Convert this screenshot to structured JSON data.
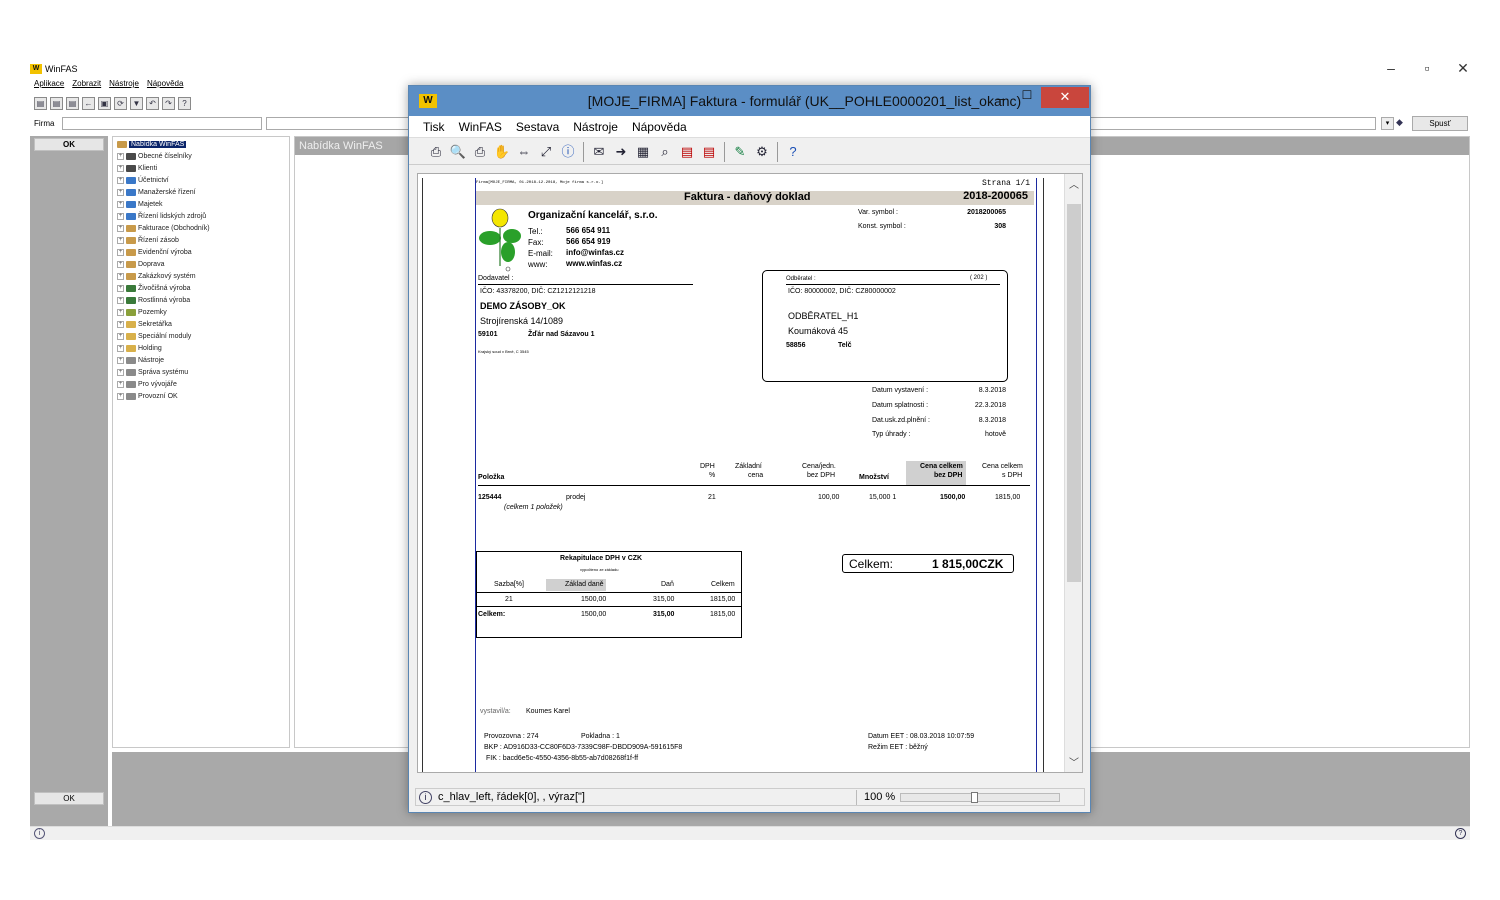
{
  "app": {
    "title": "WinFAS",
    "menu": [
      "Aplikace",
      "Zobrazit",
      "Nástroje",
      "Nápověda"
    ],
    "firma_label": "Firma",
    "spust_label": "Spusť",
    "ok_label": "OK",
    "ok_bottom_label": "OK",
    "right_header": "Nabídka WinFAS",
    "tree_root": "Nabídka WinFAS",
    "tree_items": [
      {
        "label": "Obecné číselníky",
        "color": "#4a4a4a"
      },
      {
        "label": "Klienti",
        "color": "#4a4a4a"
      },
      {
        "label": "Účetnictví",
        "color": "#3a78c8"
      },
      {
        "label": "Manažerské řízení",
        "color": "#3a78c8"
      },
      {
        "label": "Majetek",
        "color": "#3a78c8"
      },
      {
        "label": "Řízení lidských zdrojů",
        "color": "#3a78c8"
      },
      {
        "label": "Fakturace (Obchodník)",
        "color": "#c89a4a"
      },
      {
        "label": "Řízení zásob",
        "color": "#c89a4a"
      },
      {
        "label": "Evidenční výroba",
        "color": "#c89a4a"
      },
      {
        "label": "Doprava",
        "color": "#c89a4a"
      },
      {
        "label": "Zakázkový systém",
        "color": "#c89a4a"
      },
      {
        "label": "Živočišná výroba",
        "color": "#3a7a3a"
      },
      {
        "label": "Rostlinná výroba",
        "color": "#3a7a3a"
      },
      {
        "label": "Pozemky",
        "color": "#8aa03a"
      },
      {
        "label": "Sekretářka",
        "color": "#d8b04a"
      },
      {
        "label": "Speciální moduly",
        "color": "#d8b04a"
      },
      {
        "label": "Holding",
        "color": "#d8b04a"
      },
      {
        "label": "Nástroje",
        "color": "#8a8a8a"
      },
      {
        "label": "Správa systému",
        "color": "#8a8a8a"
      },
      {
        "label": "Pro vývojáře",
        "color": "#8a8a8a"
      },
      {
        "label": "Provozní OK",
        "color": "#8a8a8a"
      }
    ]
  },
  "dialog": {
    "title": "[MOJE_FIRMA] Faktura - formulář (UK__POHLE0000201_list_okanc)",
    "menu": [
      "Tisk",
      "WinFAS",
      "Sestava",
      "Nástroje",
      "Nápověda"
    ],
    "status_text": "c_hlav_left, řádek[0], , výraz[\"]",
    "zoom": "100 %",
    "zoom_fraction": 0.46
  },
  "invoice": {
    "header_left": "Firma[MOJE_FIRMA, 01.2018-12.2018, Moje firma s.r.o.]",
    "header_right": "Strana 1/1",
    "doc_title": "Faktura - daňový doklad",
    "doc_number": "2018-200065",
    "company_name": "Organizační kancelář, s.r.o.",
    "tel_label": "Tel.:",
    "tel": "566 654 911",
    "fax_label": "Fax:",
    "fax": "566 654 919",
    "email_label": "E-mail:",
    "email": "info@winfas.cz",
    "www_label": "www:",
    "www": "www.winfas.cz",
    "var_symbol_label": "Var. symbol :",
    "var_symbol": "2018200065",
    "konst_symbol_label": "Konst. symbol :",
    "konst_symbol": "308",
    "dodavatel_label": "Dodavatel :",
    "dodavatel_ico": "IČO: 43378200, DIČ: CZ1212121218",
    "dodavatel_name": "DEMO ZÁSOBY_OK",
    "dodavatel_street": "Strojírenská 14/1089",
    "dodavatel_zip": "59101",
    "dodavatel_city": "Žďár nad Sázavou 1",
    "dodavatel_court": "Krajský soud v Brně, C 3545",
    "odberatel_label": "Odběratel :",
    "odberatel_code": "( 202 )",
    "odberatel_ico": "IČO: 80000002, DIČ: CZ80000002",
    "odberatel_name": "ODBĚRATEL_H1",
    "odberatel_street": "Koumáková 45",
    "odberatel_zip": "58856",
    "odberatel_city": "Telč",
    "dates": [
      {
        "label": "Datum vystavení :",
        "value": "8.3.2018"
      },
      {
        "label": "Datum splatnosti :",
        "value": "22.3.2018"
      },
      {
        "label": "Dat.usk.zd.plnění :",
        "value": "8.3.2018"
      },
      {
        "label": "Typ úhrady :",
        "value": "hotově"
      }
    ],
    "col_polozka": "Položka",
    "col_dph_1": "DPH",
    "col_dph_2": "%",
    "col_zaklad_1": "Základní",
    "col_zaklad_2": "cena",
    "col_cena_1": "Cena/jedn.",
    "col_cena_2": "bez DPH",
    "col_mnozstvi": "Množství",
    "col_celkem_bez_1": "Cena celkem",
    "col_celkem_bez_2": "bez DPH",
    "col_celkem_s_1": "Cena celkem",
    "col_celkem_s_2": "s DPH",
    "item": {
      "code": "125444",
      "name": "prodej",
      "dph": "21",
      "cena": "100,00",
      "mnozstvi": "15,000 1",
      "celkem_bez": "1500,00",
      "celkem_s": "1815,00"
    },
    "item_count": "(celkem 1 položek)",
    "recap_title": "Rekapitulace DPH v CZK",
    "recap_subtitle": "vypočteno ze základu",
    "recap_cols": [
      "Sazba[%]",
      "Základ daně",
      "Daň",
      "Celkem"
    ],
    "recap_row": [
      "21",
      "1500,00",
      "315,00",
      "1815,00"
    ],
    "recap_total_label": "Celkem:",
    "recap_total": [
      "1500,00",
      "315,00",
      "1815,00"
    ],
    "total_label": "Celkem:",
    "total_value": "1 815,00CZK",
    "vystavila_label": "vystavil/a:",
    "vystavila": "Koumes Karel",
    "provozovna": "Provozovna : 274",
    "pokladna": "Pokladna : 1",
    "bkp": "BKP : AD916D33-CC80F6D3-7339C98F-DBDD909A-591615F8",
    "fik": "FIK : bacd6e5c-4550-4356-8b55-ab7d08268f1f-ff",
    "datum_eet": "Datum EET : 08.03.2018 10:07:59",
    "rezim_eet": "Režim EET : běžný"
  }
}
